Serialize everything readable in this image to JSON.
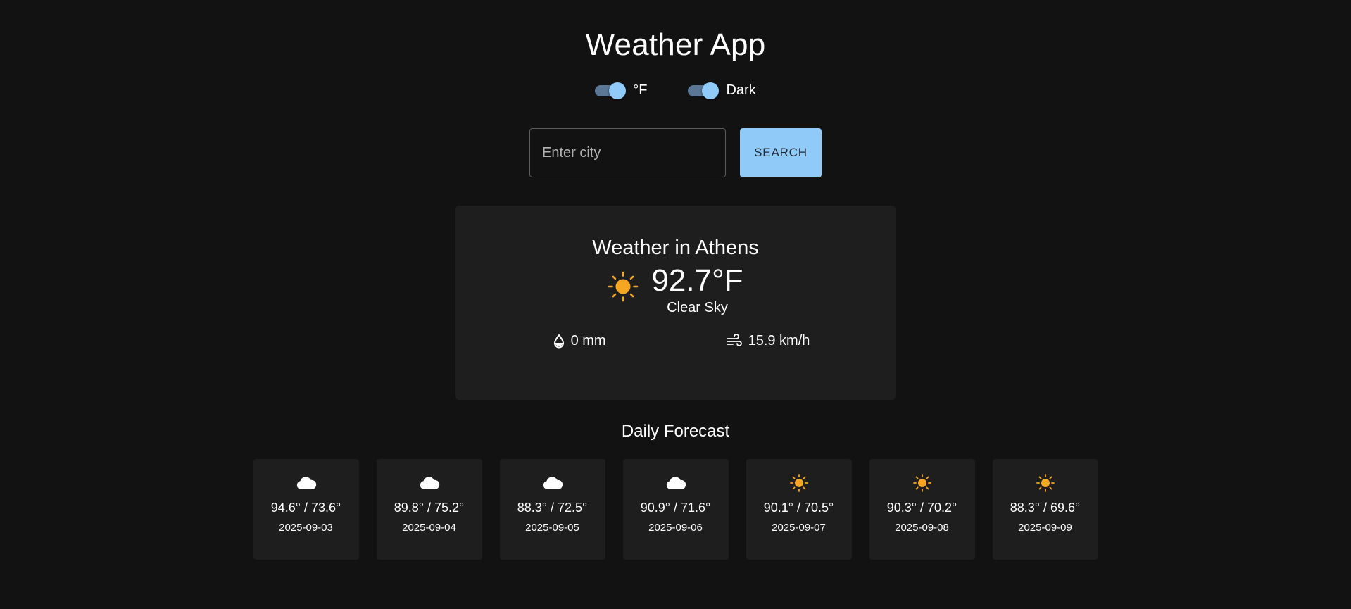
{
  "app": {
    "title": "Weather App"
  },
  "toggles": {
    "unit": {
      "label": "°F",
      "on": true
    },
    "theme": {
      "label": "Dark",
      "on": true
    }
  },
  "search": {
    "placeholder": "Enter city",
    "value": "",
    "button_label": "SEARCH"
  },
  "current": {
    "title": "Weather in Athens",
    "icon": "sun-icon",
    "temperature": "92.7°F",
    "condition": "Clear Sky",
    "precipitation": {
      "icon": "droplet-icon",
      "value": "0 mm"
    },
    "wind": {
      "icon": "wind-icon",
      "value": "15.9 km/h"
    }
  },
  "forecast": {
    "title": "Daily Forecast",
    "days": [
      {
        "icon": "cloud-icon",
        "temps": "94.6° / 73.6°",
        "date": "2025-09-03"
      },
      {
        "icon": "cloud-icon",
        "temps": "89.8° / 75.2°",
        "date": "2025-09-04"
      },
      {
        "icon": "cloud-icon",
        "temps": "88.3° / 72.5°",
        "date": "2025-09-05"
      },
      {
        "icon": "cloud-icon",
        "temps": "90.9° / 71.6°",
        "date": "2025-09-06"
      },
      {
        "icon": "sun-icon",
        "temps": "90.1° / 70.5°",
        "date": "2025-09-07"
      },
      {
        "icon": "sun-icon",
        "temps": "90.3° / 70.2°",
        "date": "2025-09-08"
      },
      {
        "icon": "sun-icon",
        "temps": "88.3° / 69.6°",
        "date": "2025-09-09"
      }
    ]
  },
  "colors": {
    "background": "#121212",
    "card": "#1e1e1e",
    "accent": "#90caf9",
    "sun": "#f5a623",
    "text": "#ffffff"
  }
}
